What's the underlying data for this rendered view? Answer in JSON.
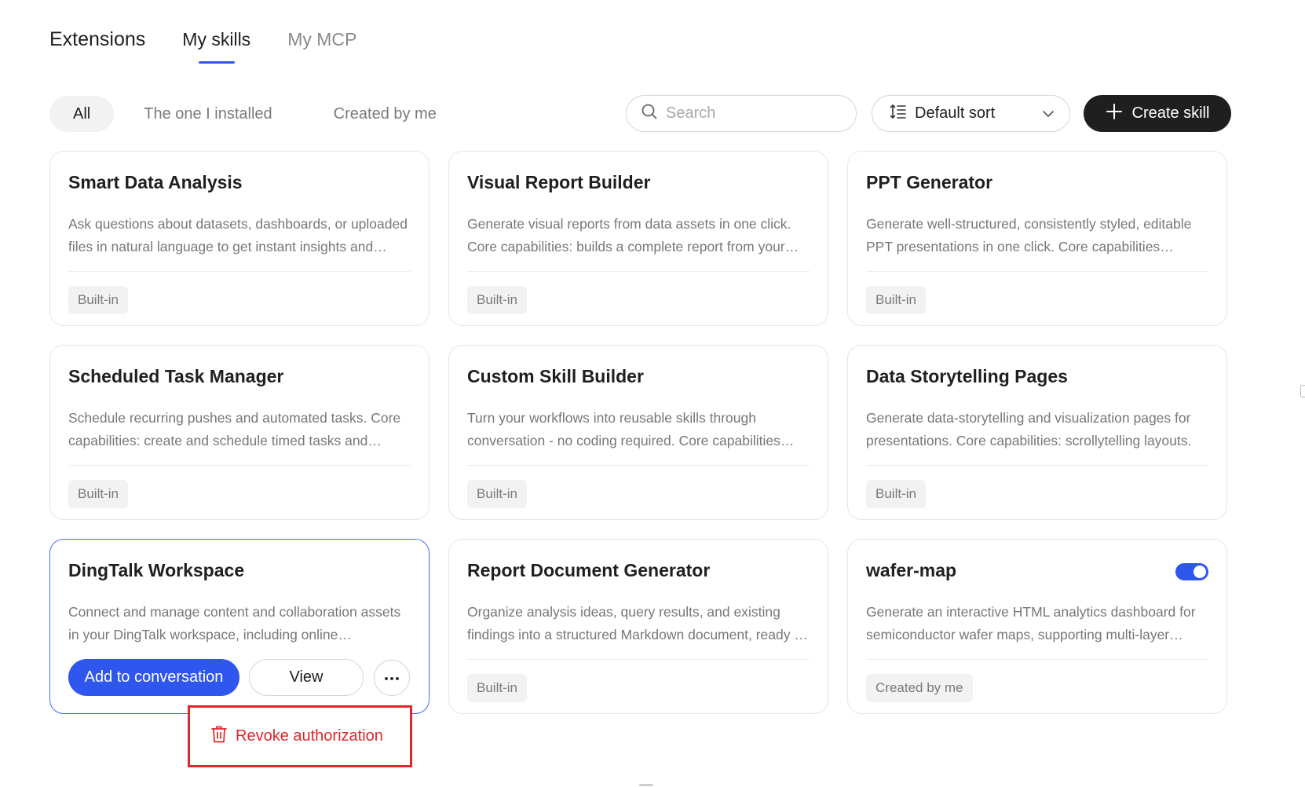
{
  "header": {
    "title": "Extensions",
    "tabs": [
      {
        "label": "My skills",
        "active": true
      },
      {
        "label": "My MCP",
        "active": false
      }
    ]
  },
  "filters": {
    "items": [
      {
        "label": "All",
        "active": true
      },
      {
        "label": "The one I installed",
        "active": false
      },
      {
        "label": "Created by me",
        "active": false
      }
    ]
  },
  "search": {
    "placeholder": "Search",
    "value": ""
  },
  "sort": {
    "label": "Default sort"
  },
  "create_button": {
    "label": "Create skill"
  },
  "cards": [
    {
      "title": "Smart Data Analysis",
      "desc": "Ask questions about datasets, dashboards, or uploaded files in natural language to get instant insights and charts.",
      "tag": "Built-in"
    },
    {
      "title": "Visual Report Builder",
      "desc": "Generate visual reports from data assets in one click. Core capabilities: builds a complete report from your data.",
      "tag": "Built-in"
    },
    {
      "title": "PPT Generator",
      "desc": "Generate well-structured, consistently styled, editable PPT presentations in one click. Core capabilities included.",
      "tag": "Built-in"
    },
    {
      "title": "Scheduled Task Manager",
      "desc": "Schedule recurring pushes and automated tasks. Core capabilities: create and schedule timed tasks and reminders.",
      "tag": "Built-in"
    },
    {
      "title": "Custom Skill Builder",
      "desc": "Turn your workflows into reusable skills through conversation - no coding required. Core capabilities included.",
      "tag": "Built-in"
    },
    {
      "title": "Data Storytelling Pages",
      "desc": "Generate data-storytelling and visualization pages for presentations. Core capabilities: scrollytelling layouts.",
      "tag": "Built-in"
    },
    {
      "title": "DingTalk Workspace",
      "desc": "Connect and manage content and collaboration assets in your DingTalk workspace, including online documents.",
      "tag": ""
    },
    {
      "title": "Report Document Generator",
      "desc": "Organize analysis ideas, query results, and existing findings into a structured Markdown document, ready to share.",
      "tag": "Built-in"
    },
    {
      "title": "wafer-map",
      "desc": "Generate an interactive HTML analytics dashboard for semiconductor wafer maps, supporting multi-layer views.",
      "tag": "Created by me",
      "enabled": true
    }
  ],
  "card_actions": {
    "add_label": "Add to conversation",
    "view_label": "View"
  },
  "menu": {
    "revoke_label": "Revoke authorization"
  },
  "colors": {
    "accent": "#2f57f0",
    "danger": "#e0262a",
    "dark_button": "#1f1f1f"
  }
}
